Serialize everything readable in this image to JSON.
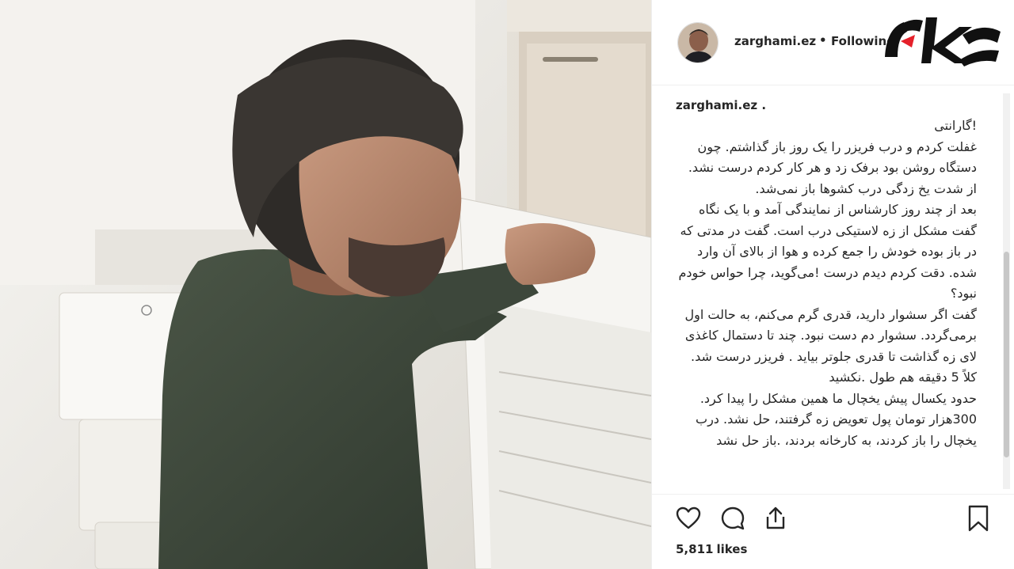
{
  "header": {
    "username": "zarghami.ez",
    "separator": "•",
    "follow_status": "Following",
    "logo_name": "rokna-logo"
  },
  "caption": {
    "username": "zarghami.ez .",
    "paragraphs": [
      "!گارانتی",
      "غفلت کردم و درب فریزر را یک روز باز گذاشتم. چون دستگاه روشن بود برفک زد و هر کار کردم درست نشد. از شدت یخ زدگی درب کشوها باز نمی‌شد.",
      "بعد از چند روز کارشناس از نمایندگی آمد و با یک نگاه گفت مشکل از زه لاستیکی درب است. گفت در مدتی که در باز بوده خودش را جمع کرده و هوا از بالای آن وارد شده. دقت کردم دیدم درست !می‌گوید، چرا حواس خودم نبود؟",
      "گفت اگر سشوار دارید، قدری گرم می‌کنم، به حالت اول برمی‌گردد. سشوار دم دست نبود. چند تا دستمال کاغذی لای زه گذاشت تا قدری جلوتر بیاید . فریزر درست شد. کلاً 5 دقیقه هم طول .نکشید",
      "حدود یکسال پیش یخچال ما همین مشکل را پیدا کرد. 300هزار تومان پول تعویض زه گرفتند، حل نشد. درب یخچال را باز کردند، به کارخانه بردند، .باز حل نشد"
    ]
  },
  "actions": {
    "like_icon": "heart-icon",
    "comment_icon": "comment-icon",
    "share_icon": "share-icon",
    "save_icon": "bookmark-icon"
  },
  "likes": {
    "count": "5,811",
    "suffix": "likes"
  },
  "colors": {
    "text": "#262626",
    "border": "#efefef",
    "logo_red": "#e5202a",
    "logo_black": "#111111"
  }
}
